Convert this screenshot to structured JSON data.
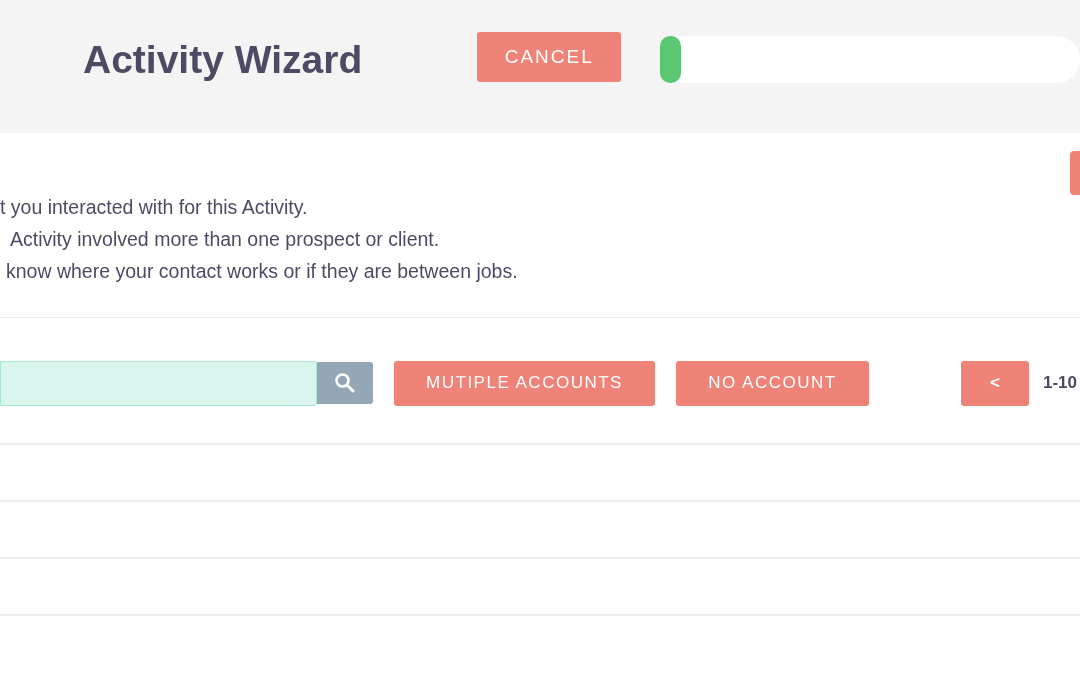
{
  "header": {
    "title": "Activity Wizard",
    "cancel_button": "CANCEL",
    "progress": {
      "level": 0.05
    }
  },
  "instructions": [
    "t you interacted with for this Activity.",
    "Activity involved more than one prospect or client.",
    "know where your contact works or if they are between jobs."
  ],
  "toolbar": {
    "buttons": [
      "MUTIPLE ACCOUNTS",
      "NO ACCOUNT"
    ],
    "prev_button": "<",
    "page_range": "1-10"
  },
  "table": {
    "rows": [
      {},
      {},
      {},
      {}
    ]
  }
}
